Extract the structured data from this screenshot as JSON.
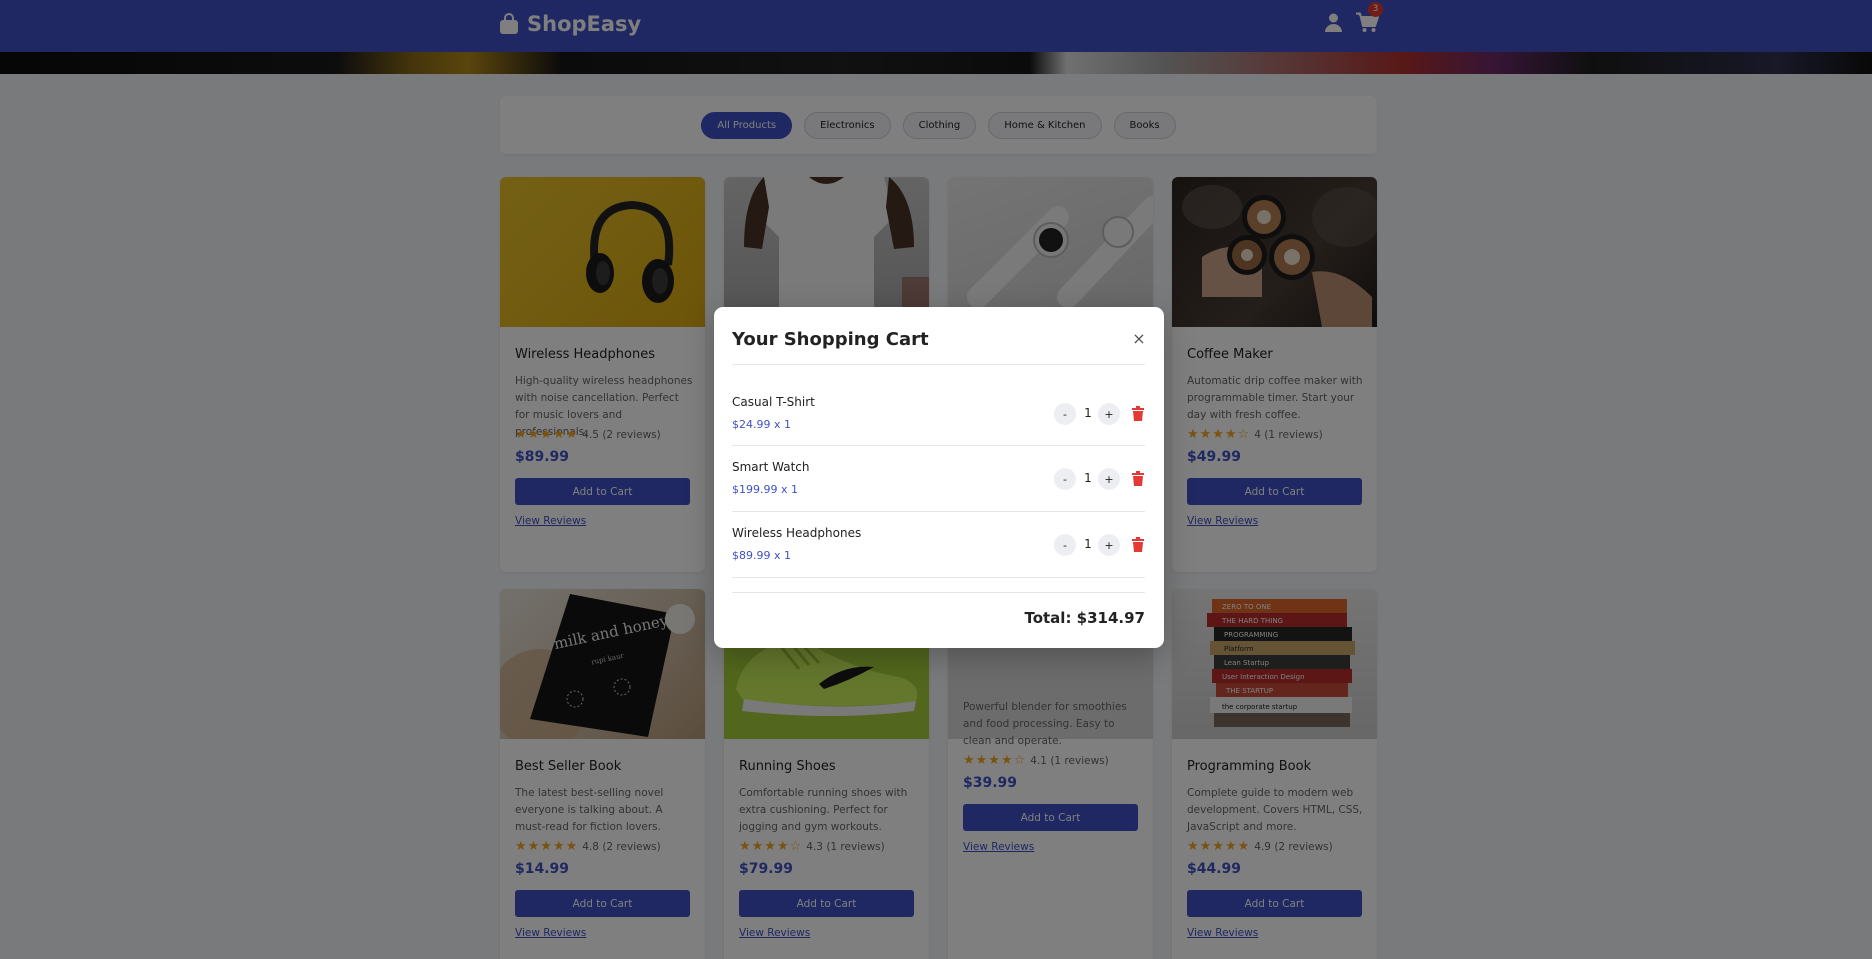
{
  "header": {
    "brand": "ShopEasy",
    "cart_count": "3"
  },
  "filters": [
    {
      "label": "All Products",
      "active": true
    },
    {
      "label": "Electronics",
      "active": false
    },
    {
      "label": "Clothing",
      "active": false
    },
    {
      "label": "Home & Kitchen",
      "active": false
    },
    {
      "label": "Books",
      "active": false
    }
  ],
  "products": [
    {
      "name": "Wireless Headphones",
      "description": "High-quality wireless headphones with noise cancellation. Perfect for music lovers and professionals.",
      "rating_stars": "★★★★★",
      "rating": "4.5 (2 reviews)",
      "price": "$89.99",
      "add_label": "Add to Cart",
      "reviews_label": "View Reviews"
    },
    {
      "name": "Coffee Maker",
      "description": "Automatic drip coffee maker with programmable timer. Start your day with fresh coffee.",
      "rating_stars": "★★★★☆",
      "rating": "4 (1 reviews)",
      "price": "$49.99",
      "add_label": "Add to Cart",
      "reviews_label": "View Reviews"
    },
    {
      "name": "Best Seller Book",
      "description": "The latest best-selling novel everyone is talking about. A must-read for fiction lovers.",
      "rating_stars": "★★★★★",
      "rating": "4.8 (2 reviews)",
      "price": "$14.99",
      "add_label": "Add to Cart",
      "reviews_label": "View Reviews"
    },
    {
      "name": "Running Shoes",
      "description": "Comfortable running shoes with extra cushioning. Perfect for jogging and gym workouts.",
      "rating_stars": "★★★★☆",
      "rating": "4.3 (1 reviews)",
      "price": "$79.99",
      "add_label": "Add to Cart",
      "reviews_label": "View Reviews"
    },
    {
      "name": "",
      "description": "Powerful blender for smoothies and food processing. Easy to clean and operate.",
      "rating_stars": "★★★★☆",
      "rating": "4.1 (1 reviews)",
      "price": "$39.99",
      "add_label": "Add to Cart",
      "reviews_label": "View Reviews"
    },
    {
      "name": "Programming Book",
      "description": "Complete guide to modern web development. Covers HTML, CSS, JavaScript and more.",
      "rating_stars": "★★★★★",
      "rating": "4.9 (2 reviews)",
      "price": "$44.99",
      "add_label": "Add to Cart",
      "reviews_label": "View Reviews"
    }
  ],
  "book_cover": {
    "title": "milk and honey",
    "author": "rupi kaur"
  },
  "book_spines": [
    "ZERO TO ONE",
    "THE HARD THING",
    "PROGRAMMING",
    "Platform",
    "Lean Startup",
    "User Interaction Design",
    "THE STARTUP",
    "the corporate startup"
  ],
  "cart": {
    "title": "Your Shopping Cart",
    "close_symbol": "×",
    "items": [
      {
        "name": "Casual T-Shirt",
        "price_line": "$24.99 x 1",
        "qty": "1"
      },
      {
        "name": "Smart Watch",
        "price_line": "$199.99 x 1",
        "qty": "1"
      },
      {
        "name": "Wireless Headphones",
        "price_line": "$89.99 x 1",
        "qty": "1"
      }
    ],
    "minus": "-",
    "plus": "+",
    "total": "Total: $314.97"
  },
  "colors": {
    "primary": "#3f51c4",
    "danger": "#e53935",
    "star": "#f5a623"
  }
}
